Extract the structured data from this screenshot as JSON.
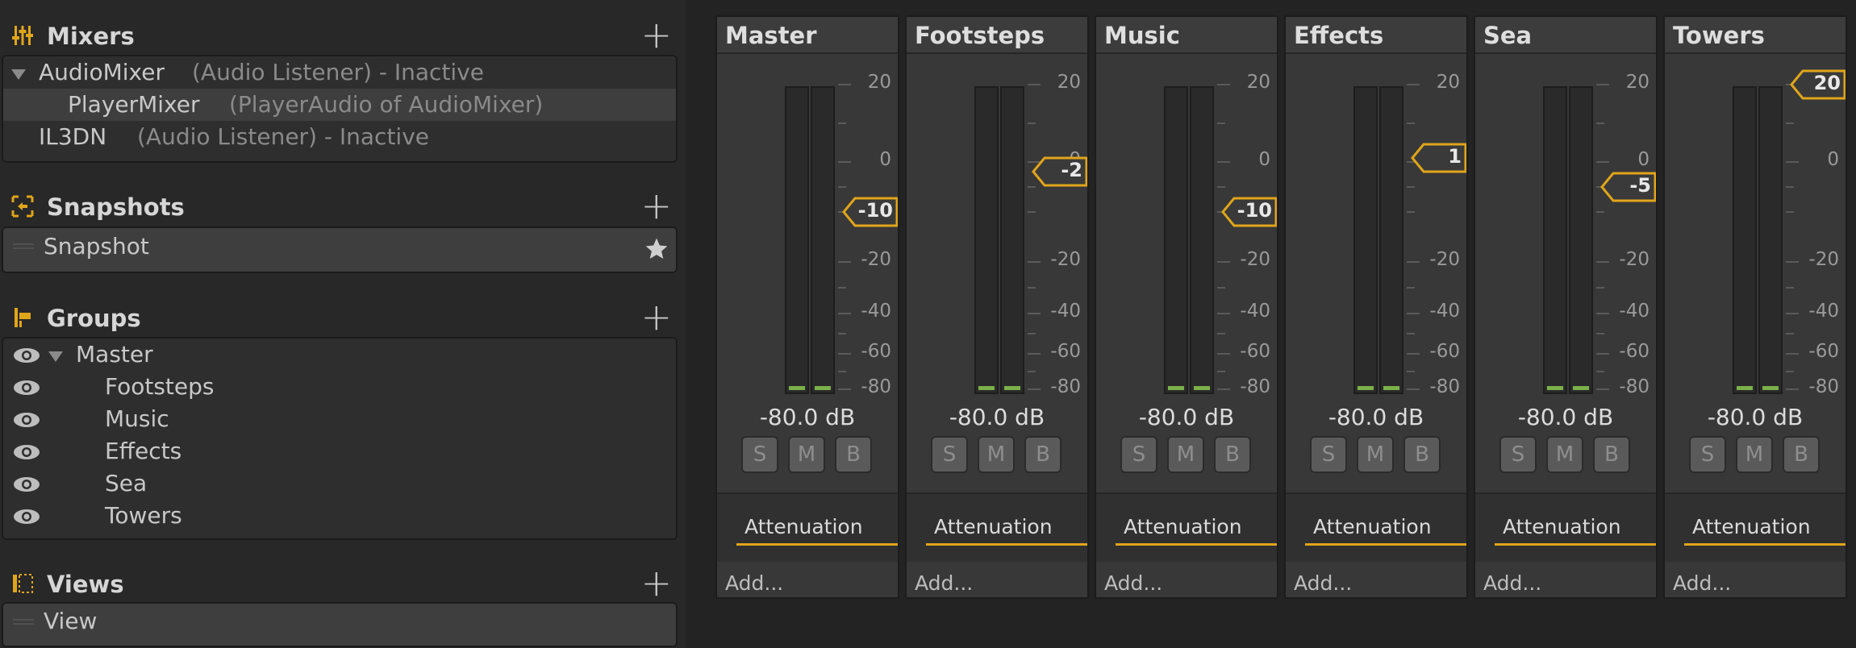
{
  "left": {
    "mixers": {
      "title": "Mixers",
      "items": [
        {
          "name": "AudioMixer",
          "detail": "(Audio Listener) - Inactive"
        },
        {
          "name": "PlayerMixer",
          "detail": "(PlayerAudio of AudioMixer)"
        },
        {
          "name": "IL3DN",
          "detail": "(Audio Listener) - Inactive"
        }
      ]
    },
    "snapshots": {
      "title": "Snapshots",
      "items": [
        "Snapshot"
      ]
    },
    "groups": {
      "title": "Groups",
      "items": [
        "Master",
        "Footsteps",
        "Music",
        "Effects",
        "Sea",
        "Towers"
      ]
    },
    "views": {
      "title": "Views",
      "items": [
        "View"
      ]
    }
  },
  "mixer": {
    "scale_labels": [
      "20",
      "0",
      "-20",
      "-40",
      "-60",
      "-80"
    ],
    "button_labels": {
      "solo": "S",
      "mute": "M",
      "bypass": "B"
    },
    "effect_label": "Attenuation",
    "add_label": "Add...",
    "strips": [
      {
        "name": "Master",
        "level": "-80.0 dB",
        "volume_label": "-10",
        "volume_db": -10
      },
      {
        "name": "Footsteps",
        "level": "-80.0 dB",
        "volume_label": "-2",
        "volume_db": -2
      },
      {
        "name": "Music",
        "level": "-80.0 dB",
        "volume_label": "-10",
        "volume_db": -10
      },
      {
        "name": "Effects",
        "level": "-80.0 dB",
        "volume_label": "1",
        "volume_db": 1
      },
      {
        "name": "Sea",
        "level": "-80.0 dB",
        "volume_label": "-5",
        "volume_db": -5
      },
      {
        "name": "Towers",
        "level": "-80.0 dB",
        "volume_label": "20",
        "volume_db": 20
      }
    ]
  },
  "colors": {
    "accent": "#e0a51a",
    "meter_level": "#7bb04a",
    "panel_bg": "#282828",
    "strip_bg": "#383838"
  },
  "icons": {
    "mixers": "mixer-sliders-icon",
    "snapshots": "snapshot-icon",
    "groups": "group-icon",
    "views": "views-icon",
    "add": "plus-icon",
    "default_snapshot": "star-icon",
    "visibility": "eye-icon"
  }
}
